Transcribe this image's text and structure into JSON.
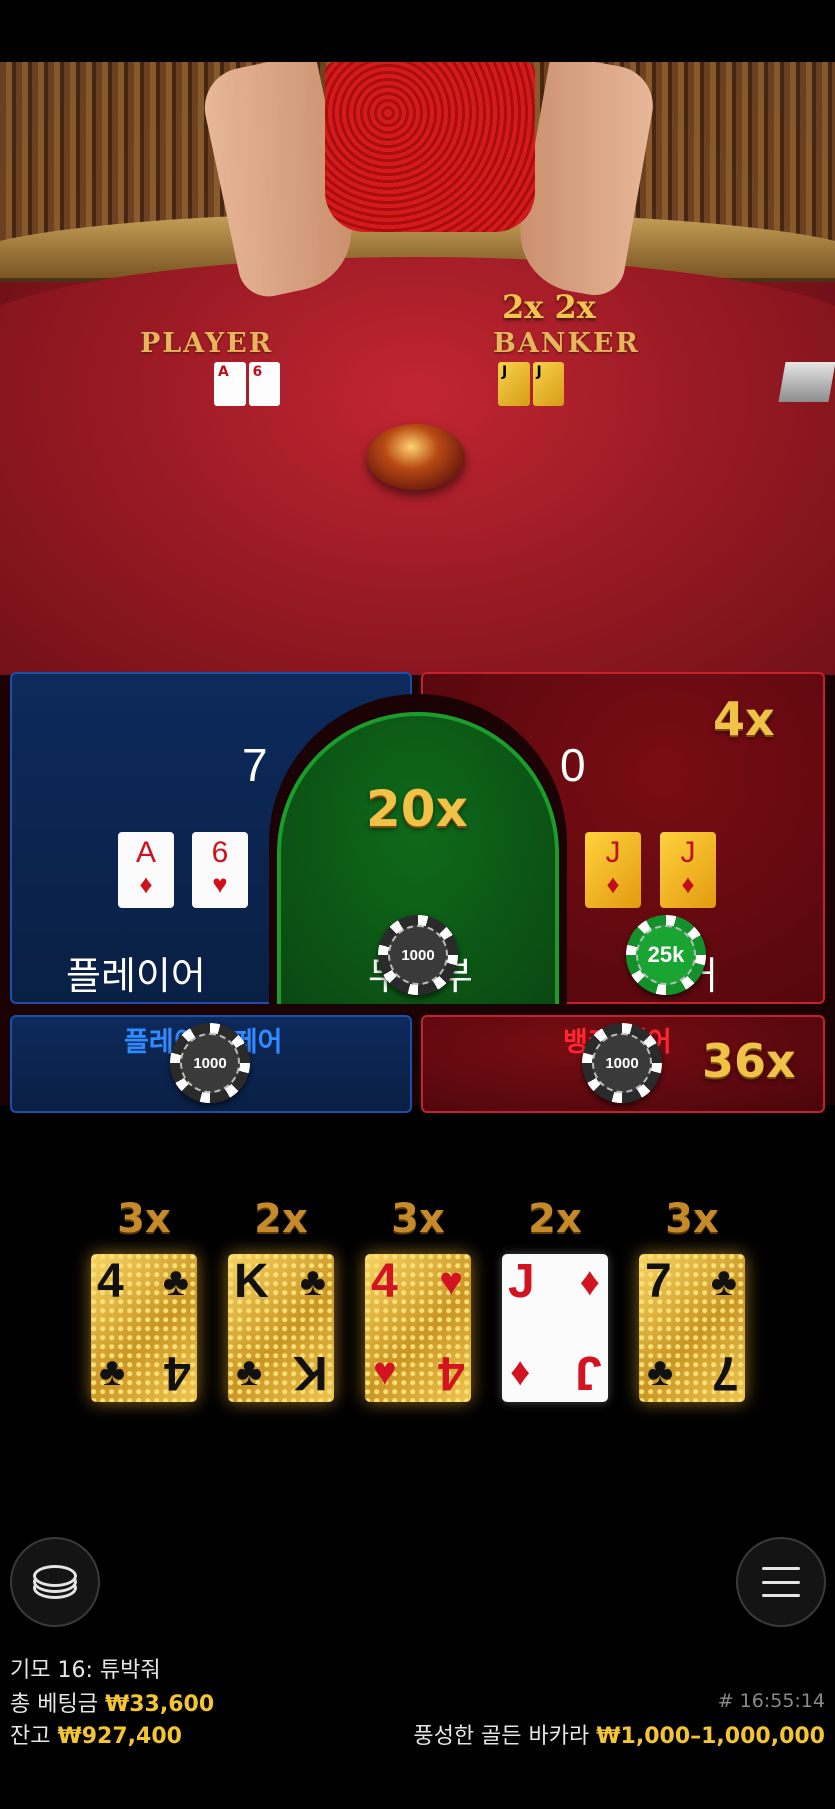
{
  "table": {
    "player_label": "PLAYER",
    "banker_label": "BANKER",
    "banker_multipliers": "2x  2x",
    "player_cards": [
      "A",
      "6"
    ],
    "banker_cards": [
      "J",
      "J"
    ]
  },
  "bet_areas": {
    "player": {
      "score": "7",
      "label": "플레이어",
      "cards": [
        {
          "rank": "A",
          "suit": "♦"
        },
        {
          "rank": "6",
          "suit": "♥"
        }
      ]
    },
    "tie": {
      "multiplier": "20x",
      "label": "무승부",
      "chip": "1000"
    },
    "banker": {
      "score": "0",
      "multiplier": "4x",
      "label": "뱅커",
      "chip": "25k",
      "cards": [
        {
          "rank": "J",
          "suit": "♦"
        },
        {
          "rank": "J",
          "suit": "♦"
        }
      ]
    },
    "player_pair": {
      "label": "플레이어 페어",
      "chip": "1000"
    },
    "banker_pair": {
      "label": "뱅커 페어",
      "chip": "1000",
      "multiplier": "36x"
    }
  },
  "lucky_cards": [
    {
      "multiplier": "3x",
      "rank": "4",
      "suit": "♣",
      "style": "gold"
    },
    {
      "multiplier": "2x",
      "rank": "K",
      "suit": "♣",
      "style": "gold"
    },
    {
      "multiplier": "3x",
      "rank": "4",
      "suit": "♥",
      "style": "gold"
    },
    {
      "multiplier": "2x",
      "rank": "J",
      "suit": "♦",
      "style": "white"
    },
    {
      "multiplier": "3x",
      "rank": "7",
      "suit": "♣",
      "style": "gold"
    }
  ],
  "controls": {
    "chip_stack_icon": "chip-stack-icon",
    "menu_icon": "hamburger-menu-icon"
  },
  "footer": {
    "dealer_line": "기모 16: 튜박줘",
    "total_bet_label": "총 베팅금",
    "total_bet_value": "₩33,600",
    "balance_label": "잔고",
    "balance_value": "₩927,400",
    "timestamp": "# 16:55:14",
    "table_name": "풍성한 골든 바카라",
    "bet_limits": "₩1,000–1,000,000"
  },
  "colors": {
    "accent_gold": "#f5c531",
    "player_blue": "#0d2a5c",
    "banker_red": "#7a0d14",
    "tie_green": "#0f6a1a"
  }
}
